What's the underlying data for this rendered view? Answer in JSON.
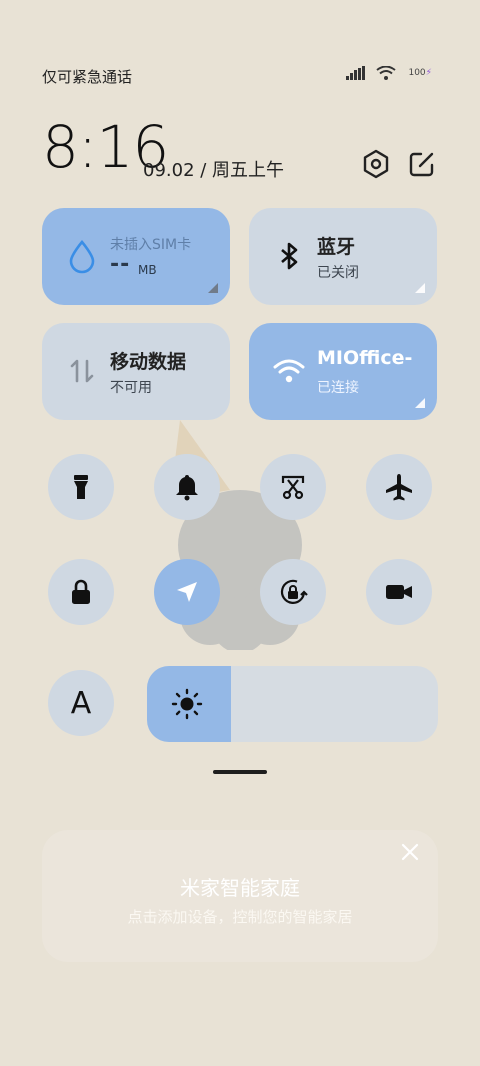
{
  "status": {
    "left_text": "仅可紧急通话",
    "battery": "100",
    "icons": [
      "signal-icon",
      "wifi-icon",
      "battery-icon"
    ]
  },
  "header": {
    "time": "8:16",
    "date": "09.02 / 周五上午",
    "icons": [
      "settings-hex-icon",
      "edit-icon"
    ]
  },
  "tiles": {
    "sim": {
      "title": "未插入SIM卡",
      "value": "--",
      "unit": "MB",
      "icon": "water-drop-icon"
    },
    "bluetooth": {
      "title": "蓝牙",
      "subtitle": "已关闭",
      "icon": "bluetooth-icon"
    },
    "mobile_data": {
      "title": "移动数据",
      "subtitle": "不可用",
      "icon": "data-arrows-icon"
    },
    "wifi": {
      "title": "MIOffice-",
      "subtitle": "已连接",
      "icon": "wifi-icon"
    }
  },
  "toggles": {
    "row1": [
      "flashlight-icon",
      "bell-icon",
      "screenshot-scissors-icon",
      "airplane-icon"
    ],
    "row2": [
      "lock-icon",
      "location-icon",
      "rotation-lock-icon",
      "video-camera-icon"
    ],
    "font_letter": "A"
  },
  "brightness": {
    "level": 0.29,
    "icon": "sun-icon"
  },
  "mijia": {
    "title": "米家智能家庭",
    "subtitle": "点击添加设备，控制您的智能家居",
    "icon": "close-icon"
  },
  "colors": {
    "background": "#e8e2d5",
    "tile_off": "#cfd8e2",
    "tile_on": "#94b8e6",
    "accent_blue": "#3a8ee6"
  }
}
